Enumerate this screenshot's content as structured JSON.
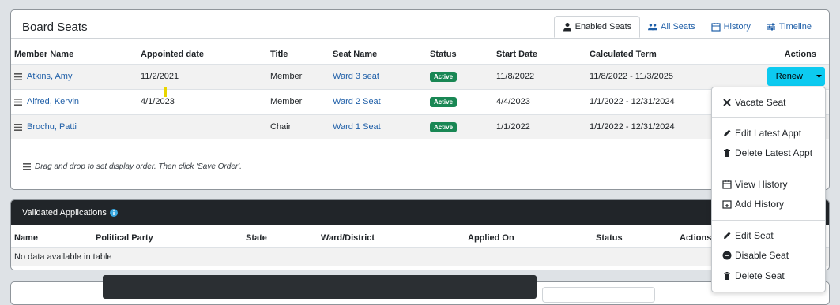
{
  "board": {
    "title": "Board Seats",
    "tabs": [
      {
        "label": "Enabled Seats",
        "icon": "user-icon"
      },
      {
        "label": "All Seats",
        "icon": "users-icon"
      },
      {
        "label": "History",
        "icon": "calendar-icon"
      },
      {
        "label": "Timeline",
        "icon": "sliders-icon"
      }
    ],
    "columns": [
      "Member Name",
      "Appointed date",
      "Title",
      "Seat Name",
      "Status",
      "Start Date",
      "Calculated Term",
      "Actions"
    ],
    "rows": [
      {
        "member": "Atkins, Amy",
        "appointed": "11/2/2021",
        "title": "Member",
        "seat": "Ward 3 seat",
        "status": "Active",
        "start": "11/8/2022",
        "term": "11/8/2022 - 11/3/2025"
      },
      {
        "member": "Alfred, Kervin",
        "appointed": "4/1/2023",
        "title": "Member",
        "seat": "Ward 2 Seat",
        "status": "Active",
        "start": "4/4/2023",
        "term": "1/1/2022 - 12/31/2024"
      },
      {
        "member": "Brochu, Patti",
        "appointed": "",
        "title": "Chair",
        "seat": "Ward 1 Seat",
        "status": "Active",
        "start": "1/1/2022",
        "term": "1/1/2022 - 12/31/2024"
      }
    ],
    "renew_label": "Renew",
    "footer_note": "Drag and drop to set display order. Then click 'Save Order'."
  },
  "applications": {
    "title": "Validated Applications",
    "columns": [
      "Name",
      "Political Party",
      "State",
      "Ward/District",
      "Applied On",
      "Status",
      "Actions"
    ],
    "empty_text": "No data available in table"
  },
  "action_menu": {
    "items": [
      {
        "label": "Vacate Seat",
        "icon": "close-icon"
      },
      {
        "label": "Edit Latest Appt",
        "icon": "pencil-icon"
      },
      {
        "label": "Delete Latest Appt",
        "icon": "trash-icon"
      },
      {
        "label": "View History",
        "icon": "calendar-icon"
      },
      {
        "label": "Add History",
        "icon": "calendar-plus-icon"
      },
      {
        "label": "Edit Seat",
        "icon": "pencil-icon"
      },
      {
        "label": "Disable Seat",
        "icon": "minus-circle-icon"
      },
      {
        "label": "Delete Seat",
        "icon": "trash-icon"
      }
    ]
  },
  "colors": {
    "link": "#1f5fa8",
    "active_badge": "#198754",
    "renew_button": "#0dcaf0",
    "dark_header": "#212529"
  }
}
